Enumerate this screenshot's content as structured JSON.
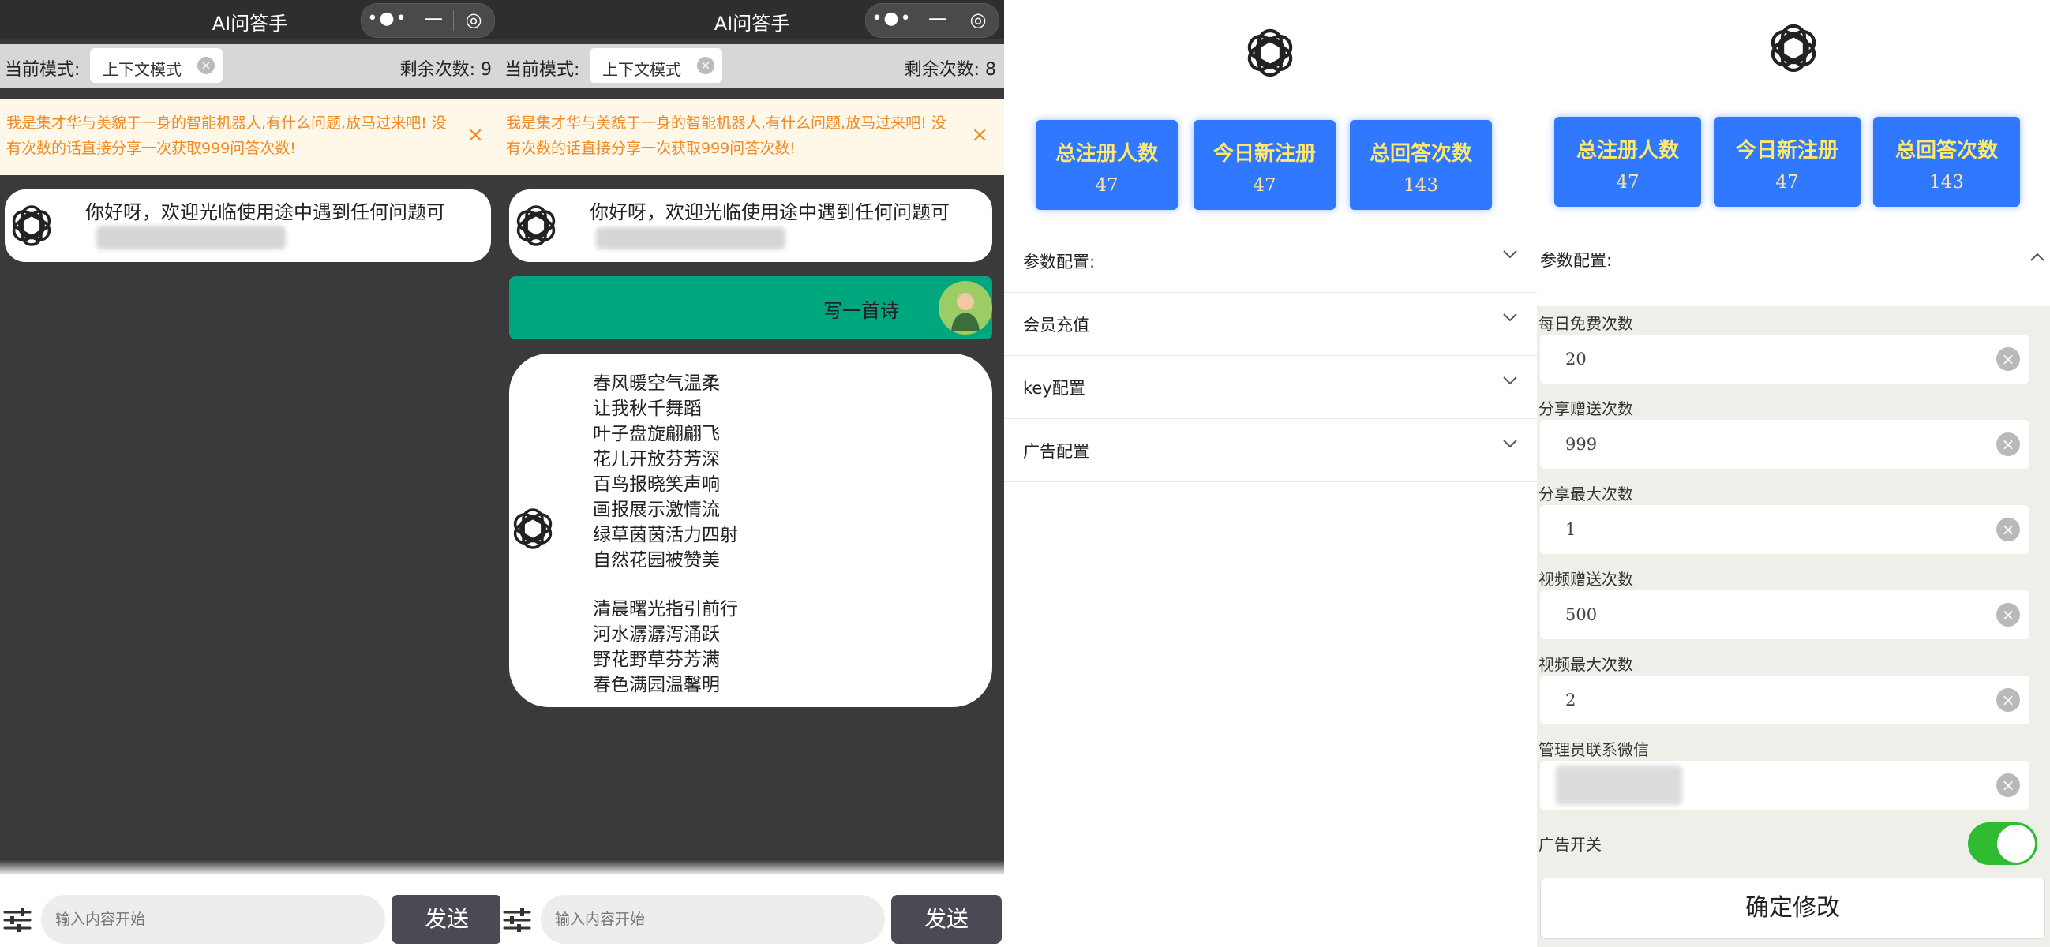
{
  "chat_window": {
    "app_title": "AI问答手",
    "capsule_more": "•●•",
    "capsule_minimize": "—",
    "capsule_target": "◎",
    "mode_label": "当前模式:",
    "mode_chip": "上下文模式",
    "notice": "我是集才华与美貌于一身的智能机器人,有什么问题,放马过来吧! 没有次数的话直接分享一次获取999问答次数!",
    "greeting": "你好呀，欢迎光临使用途中遇到任何问题可",
    "input_placeholder": "输入内容开始",
    "send_label": "发送"
  },
  "chat1": {
    "remaining": "剩余次数: 9"
  },
  "chat2": {
    "remaining": "剩余次数: 8",
    "user_message": "写一首诗",
    "poem": [
      "春风暖空气温柔",
      "让我秋千舞蹈",
      "叶子盘旋翩翩飞",
      "花儿开放芬芳深",
      "百鸟报晓笑声响",
      "画报展示激情流",
      "绿草茵茵活力四射",
      "自然花园被赞美",
      "清晨曙光指引前行",
      "河水潺潺泻涌跃",
      "野花野草芬芳满",
      "春色满园温馨明"
    ]
  },
  "admin": {
    "stats": [
      {
        "label": "总注册人数",
        "value": "47"
      },
      {
        "label": "今日新注册",
        "value": "47"
      },
      {
        "label": "总回答次数",
        "value": "143"
      }
    ],
    "sections": [
      "参数配置:",
      "会员充值",
      "key配置",
      "广告配置"
    ],
    "config_title": "参数配置:",
    "fields": [
      {
        "label": "每日免费次数",
        "value": "20"
      },
      {
        "label": "分享赠送次数",
        "value": "999"
      },
      {
        "label": "分享最大次数",
        "value": "1"
      },
      {
        "label": "视频赠送次数",
        "value": "500"
      },
      {
        "label": "视频最大次数",
        "value": "2"
      },
      {
        "label": "管理员联系微信",
        "value": ""
      }
    ],
    "ad_switch_label": "广告开关",
    "ad_switch_on": true,
    "confirm_label": "确定修改"
  },
  "colors": {
    "chat_bg": "#3a3a3a",
    "accent_green": "#00a67e",
    "stat_blue": "#2f78ff",
    "notice_orange": "#f08a24",
    "toggle_green": "#2fbb32"
  },
  "icons": [
    "openai-logo-icon",
    "settings-sliders-icon",
    "chevron-down-icon",
    "chevron-up-icon",
    "clear-icon",
    "close-icon"
  ]
}
